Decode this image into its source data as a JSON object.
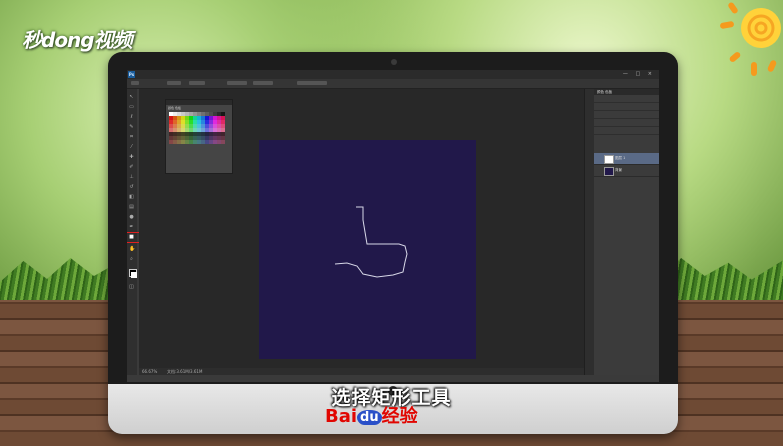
{
  "brand": {
    "logo_text": "秒dong视频"
  },
  "caption": "选择矩形工具",
  "watermark": {
    "part1": "Bai",
    "part2": "du",
    "part3": "经验"
  },
  "photoshop": {
    "logo": "Ps",
    "menu": [
      "文件(F)",
      "编辑(E)",
      "图像(I)",
      "图层(L)",
      "文字(Y)",
      "选择(S)",
      "滤镜(T)",
      "3D(D)",
      "视图(V)",
      "窗口(W)",
      "帮助(H)"
    ],
    "window_controls": "— □ ×",
    "swatch_panel_title": "颜色 色板",
    "status_zoom": "66.67%",
    "status_doc": "文档:3.61M/3.61M",
    "right_panel_tab": "颜色 色板",
    "layers": [
      {
        "name": "图层 1",
        "selected": true
      },
      {
        "name": "背景",
        "selected": false
      }
    ],
    "canvas_color": "#21184a",
    "highlight_color": "#e02020",
    "selected_tool": "rectangle-tool"
  },
  "colors": {
    "accent_red": "#e10601",
    "accent_blue": "#2a50c8"
  }
}
